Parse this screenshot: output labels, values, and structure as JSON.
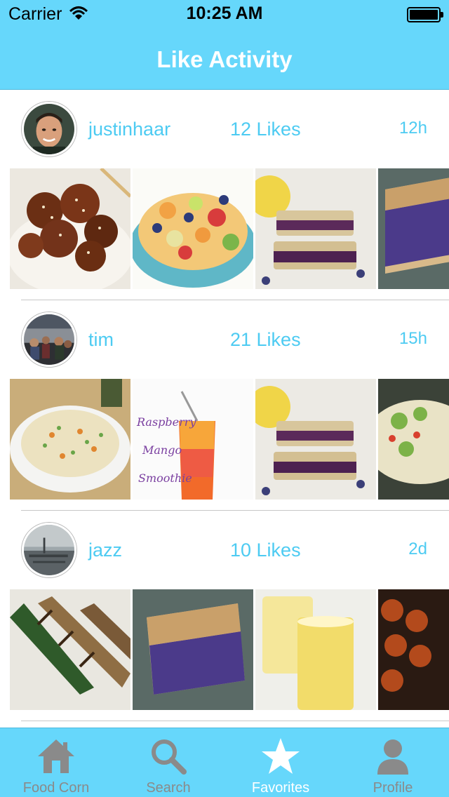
{
  "status_bar": {
    "carrier": "Carrier",
    "time": "10:25 AM"
  },
  "nav": {
    "title": "Like Activity"
  },
  "feed": [
    {
      "username": "justinhaar",
      "likes": "12 Likes",
      "age": "12h",
      "photos": [
        "sesame-chicken-photo",
        "fruit-salad-photo",
        "blueberry-crumble-bars-photo",
        "blueberry-pie-photo"
      ]
    },
    {
      "username": "tim",
      "likes": "21 Likes",
      "age": "15h",
      "photos": [
        "fried-rice-photo",
        "smoothie-photo",
        "blueberry-crumble-bars-photo",
        "pasta-salad-photo"
      ]
    },
    {
      "username": "jazz",
      "likes": "10 Likes",
      "age": "2d",
      "photos": [
        "grilled-zucchini-photo",
        "blueberry-pie-photo",
        "lemonade-photo",
        "meatballs-photo"
      ]
    }
  ],
  "smoothie_text": [
    "Raspberry",
    "Mango",
    "Smoothie"
  ],
  "tabs": [
    {
      "label": "Food  Corn",
      "icon": "house-icon",
      "active": false
    },
    {
      "label": "Search",
      "icon": "search-icon",
      "active": false
    },
    {
      "label": "Favorites",
      "icon": "star-icon",
      "active": true
    },
    {
      "label": "Profile",
      "icon": "person-icon",
      "active": false
    }
  ],
  "colors": {
    "accent": "#66d7fb",
    "text_accent": "#4dcbf2",
    "tab_inactive": "#8a8a8a"
  }
}
